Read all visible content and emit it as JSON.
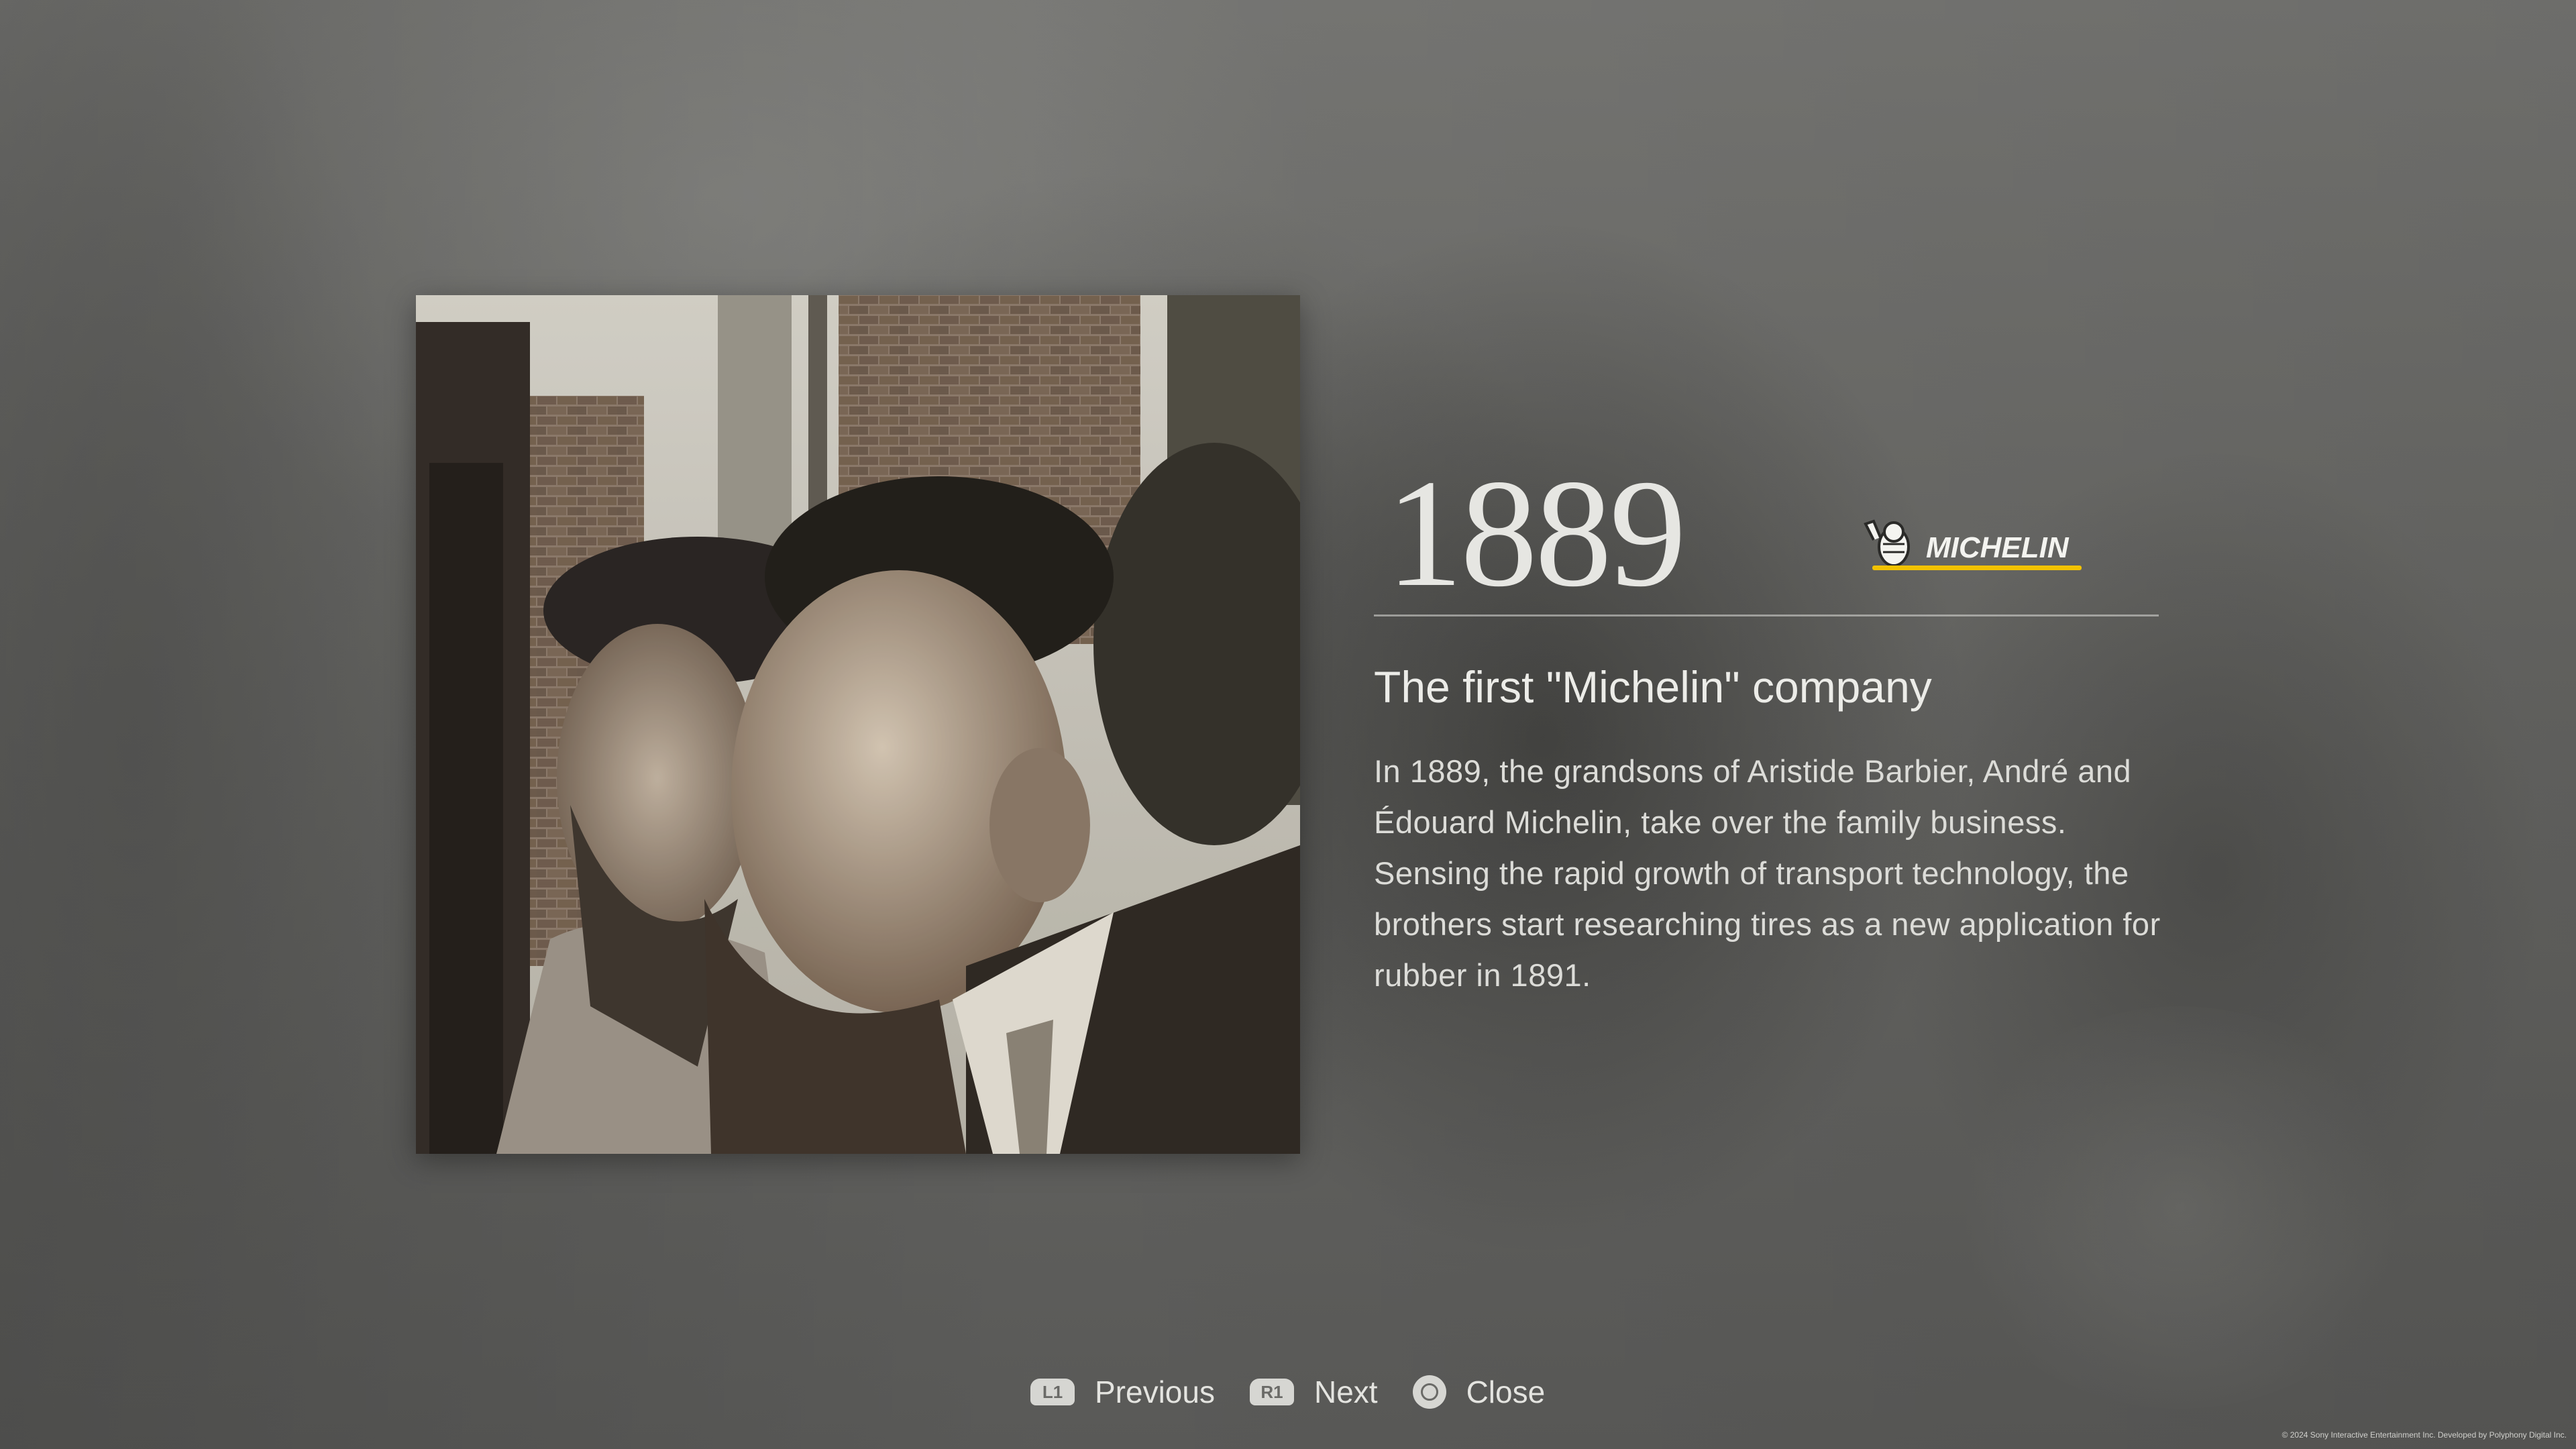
{
  "entry": {
    "year": "1889",
    "brand_wordmark": "MICHELIN",
    "title": "The first \"Michelin\" company",
    "body": "In 1889, the grandsons of Aristide Barbier, André and Édouard Michelin, take over the family business. Sensing the rapid growth of transport technology, the brothers start researching tires as a new application for rubber in 1891."
  },
  "controls": {
    "previous": {
      "button": "L1",
      "label": "Previous"
    },
    "next": {
      "button": "R1",
      "label": "Next"
    },
    "close": {
      "button_icon": "circle-button-icon",
      "label": "Close"
    }
  },
  "footer": {
    "copyright": "© 2024 Sony Interactive Entertainment Inc. Developed by Polyphony Digital Inc."
  },
  "colors": {
    "brand_yellow": "#f2c200",
    "text_primary": "#ecece8"
  }
}
